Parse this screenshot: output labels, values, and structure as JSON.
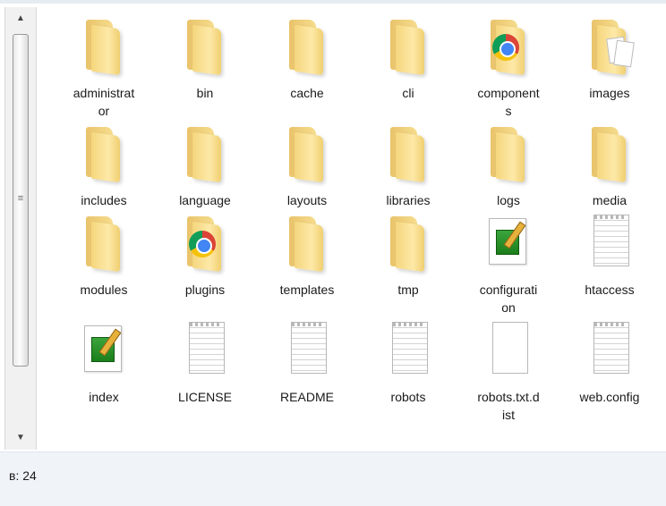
{
  "status": {
    "count_text": "в: 24"
  },
  "files": [
    {
      "name": "administrator",
      "label": "administrat\nor",
      "icon": "folder-icon"
    },
    {
      "name": "bin",
      "label": "bin",
      "icon": "folder-icon"
    },
    {
      "name": "cache",
      "label": "cache",
      "icon": "folder-icon"
    },
    {
      "name": "cli",
      "label": "cli",
      "icon": "folder-icon"
    },
    {
      "name": "components",
      "label": "component\ns",
      "icon": "chrome-folder-icon"
    },
    {
      "name": "images",
      "label": "images",
      "icon": "images-folder-icon"
    },
    {
      "name": "includes",
      "label": "includes",
      "icon": "folder-icon"
    },
    {
      "name": "language",
      "label": "language",
      "icon": "folder-icon"
    },
    {
      "name": "layouts",
      "label": "layouts",
      "icon": "folder-icon"
    },
    {
      "name": "libraries",
      "label": "libraries",
      "icon": "folder-icon"
    },
    {
      "name": "logs",
      "label": "logs",
      "icon": "folder-icon"
    },
    {
      "name": "media",
      "label": "media",
      "icon": "folder-icon"
    },
    {
      "name": "modules",
      "label": "modules",
      "icon": "folder-icon"
    },
    {
      "name": "plugins",
      "label": "plugins",
      "icon": "chrome-folder-icon"
    },
    {
      "name": "templates",
      "label": "templates",
      "icon": "folder-icon"
    },
    {
      "name": "tmp",
      "label": "tmp",
      "icon": "folder-icon"
    },
    {
      "name": "configuration",
      "label": "configurati\non",
      "icon": "php-file-icon"
    },
    {
      "name": "htaccess",
      "label": "htaccess",
      "icon": "text-file-icon"
    },
    {
      "name": "index",
      "label": "index",
      "icon": "php-file-icon"
    },
    {
      "name": "LICENSE",
      "label": "LICENSE",
      "icon": "text-file-icon"
    },
    {
      "name": "README",
      "label": "README",
      "icon": "text-file-icon"
    },
    {
      "name": "robots",
      "label": "robots",
      "icon": "text-file-icon"
    },
    {
      "name": "robots.txt.dist",
      "label": "robots.txt.d\nist",
      "icon": "blank-file-icon"
    },
    {
      "name": "web.config",
      "label": "web.config",
      "icon": "text-file-icon"
    }
  ],
  "scrollbar": {
    "up_icon": "scroll-up-arrow-icon",
    "down_icon": "scroll-down-arrow-icon"
  }
}
